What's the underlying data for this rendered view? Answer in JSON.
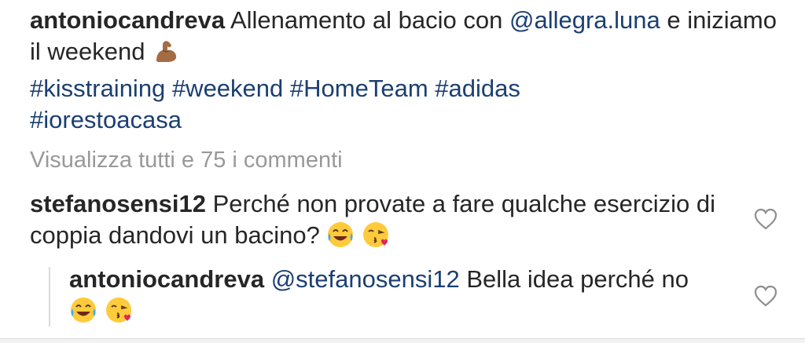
{
  "caption": {
    "username": "antoniocandreva",
    "text_part1": "Allenamento al bacio con",
    "mention": "@allegra.luna",
    "text_part2": "e iniziamo il weekend",
    "emoji": "flexed-biceps",
    "hashtags": [
      "#kisstraining",
      "#weekend",
      "#HomeTeam",
      "#adidas",
      "#iorestoacasa"
    ]
  },
  "view_all_comments": "Visualizza tutti e 75 i commenti",
  "comment": {
    "username": "stefanosensi12",
    "text": "Perché non provate a fare qualche esercizio di coppia dandovi un bacino?",
    "emojis": [
      "face-with-tears-of-joy",
      "face-blowing-a-kiss"
    ]
  },
  "reply": {
    "username": "antoniocandreva",
    "mention": "@stefanosensi12",
    "text": "Bella idea perché no",
    "emojis": [
      "face-with-tears-of-joy",
      "face-blowing-a-kiss"
    ]
  }
}
